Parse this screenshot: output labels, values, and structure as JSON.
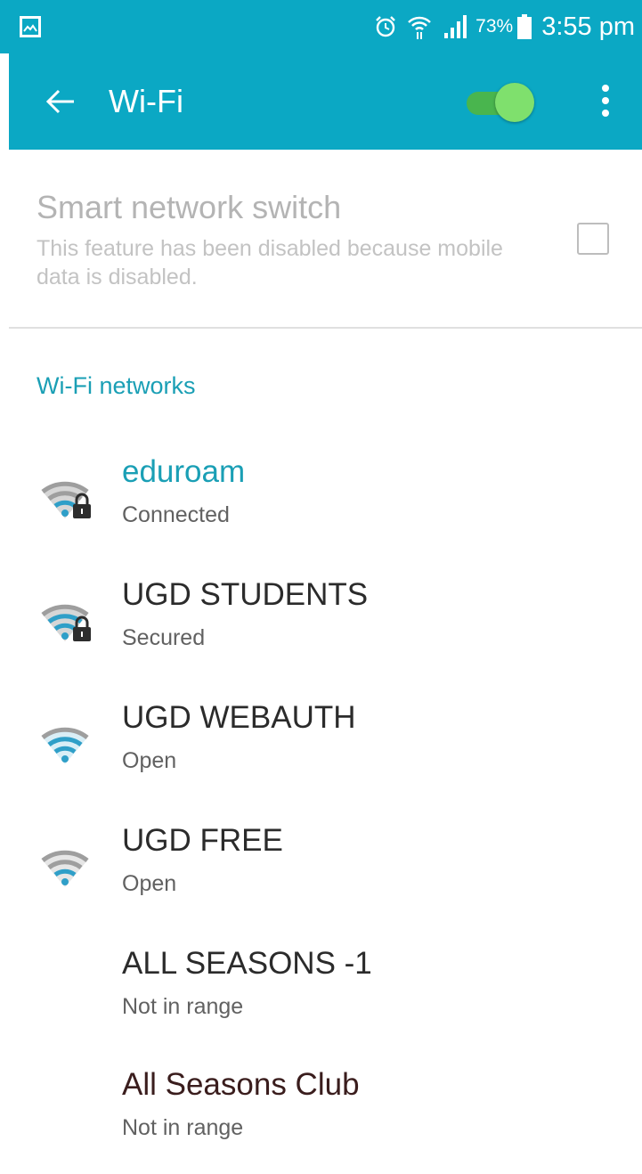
{
  "status_bar": {
    "battery_percent": "73%",
    "time": "3:55 pm",
    "icons": [
      "gallery-icon",
      "alarm-icon",
      "wifi-transfer-icon",
      "signal-icon",
      "battery-icon"
    ]
  },
  "app_bar": {
    "title": "Wi-Fi",
    "wifi_enabled": true,
    "colors": {
      "background": "#0ba8c4",
      "toggle_on": "#7fe06d"
    }
  },
  "smart_switch": {
    "title": "Smart network switch",
    "description": "This feature has been disabled because mobile data is disabled.",
    "checked": false,
    "enabled": false
  },
  "networks_header": "Wi-Fi networks",
  "networks": [
    {
      "name": "eduroam",
      "status": "Connected",
      "icon": "wifi-locked-icon",
      "name_color": "#1a9fb5"
    },
    {
      "name": "UGD STUDENTS",
      "status": "Secured",
      "icon": "wifi-locked-icon",
      "name_color": "#2b2b2b"
    },
    {
      "name": "UGD WEBAUTH",
      "status": "Open",
      "icon": "wifi-open-icon",
      "name_color": "#2b2b2b"
    },
    {
      "name": "UGD FREE",
      "status": "Open",
      "icon": "wifi-open-icon",
      "name_color": "#2b2b2b"
    },
    {
      "name": "ALL SEASONS -1",
      "status": "Not in range",
      "icon": "",
      "name_color": "#2b2b2b"
    },
    {
      "name": "All Seasons Club",
      "status": "Not in range",
      "icon": "",
      "name_color": "#3a1d1d"
    }
  ]
}
